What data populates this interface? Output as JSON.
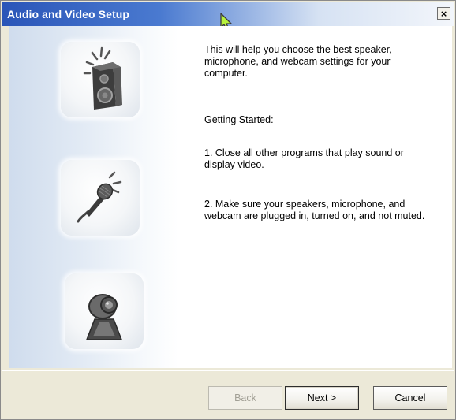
{
  "window": {
    "title": "Audio and Video Setup",
    "close_label": "×"
  },
  "icons": {
    "speaker": "speaker-icon",
    "microphone": "microphone-icon",
    "webcam": "webcam-icon"
  },
  "body": {
    "intro": "This will help you choose the best speaker, microphone, and webcam settings for your computer.",
    "getting_started": "Getting Started:",
    "step1": "1. Close all other programs that play sound or display video.",
    "step2": "2. Make sure your speakers, microphone, and webcam are plugged in, turned on, and not muted."
  },
  "buttons": {
    "back": "Back",
    "next": "Next >",
    "cancel": "Cancel"
  },
  "colors": {
    "titlebar_start": "#2a55b8",
    "window_bg": "#ece9d8"
  }
}
